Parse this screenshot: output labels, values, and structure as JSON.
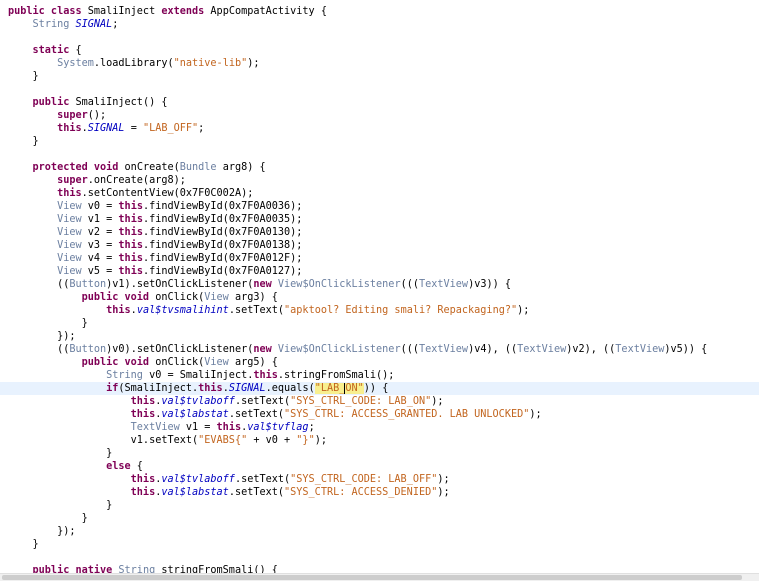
{
  "editor": {
    "current_line_index": 29,
    "lines": [
      [
        {
          "t": "public class ",
          "c": "k"
        },
        {
          "t": "SmaliInject ",
          "c": "h"
        },
        {
          "t": "extends ",
          "c": "k"
        },
        {
          "t": "AppCompatActivity {",
          "c": "h"
        }
      ],
      [
        {
          "t": "    ",
          "c": "n"
        },
        {
          "t": "String ",
          "c": "ty"
        },
        {
          "t": "SIGNAL",
          "c": "it"
        },
        {
          "t": ";",
          "c": "n"
        }
      ],
      [],
      [
        {
          "t": "    static",
          "c": "k"
        },
        {
          "t": " {",
          "c": "n"
        }
      ],
      [
        {
          "t": "        ",
          "c": "n"
        },
        {
          "t": "System",
          "c": "ty"
        },
        {
          "t": ".loadLibrary(",
          "c": "n"
        },
        {
          "t": "\"native-lib\"",
          "c": "s"
        },
        {
          "t": ");",
          "c": "n"
        }
      ],
      [
        {
          "t": "    }",
          "c": "n"
        }
      ],
      [],
      [
        {
          "t": "    public ",
          "c": "k"
        },
        {
          "t": "SmaliInject",
          "c": "h"
        },
        {
          "t": "() {",
          "c": "n"
        }
      ],
      [
        {
          "t": "        super",
          "c": "k"
        },
        {
          "t": "();",
          "c": "n"
        }
      ],
      [
        {
          "t": "        this",
          "c": "k"
        },
        {
          "t": ".",
          "c": "n"
        },
        {
          "t": "SIGNAL",
          "c": "it"
        },
        {
          "t": " = ",
          "c": "n"
        },
        {
          "t": "\"LAB_OFF\"",
          "c": "s"
        },
        {
          "t": ";",
          "c": "n"
        }
      ],
      [
        {
          "t": "    }",
          "c": "n"
        }
      ],
      [],
      [
        {
          "t": "    protected void ",
          "c": "k"
        },
        {
          "t": "onCreate(",
          "c": "n"
        },
        {
          "t": "Bundle ",
          "c": "ty"
        },
        {
          "t": "arg8) {",
          "c": "n"
        }
      ],
      [
        {
          "t": "        super",
          "c": "k"
        },
        {
          "t": ".onCreate(arg8);",
          "c": "n"
        }
      ],
      [
        {
          "t": "        this",
          "c": "k"
        },
        {
          "t": ".setContentView(",
          "c": "n"
        },
        {
          "t": "0x7F0C002A",
          "c": "n"
        },
        {
          "t": ");",
          "c": "n"
        }
      ],
      [
        {
          "t": "        ",
          "c": "n"
        },
        {
          "t": "View ",
          "c": "ty"
        },
        {
          "t": "v0 = ",
          "c": "n"
        },
        {
          "t": "this",
          "c": "k"
        },
        {
          "t": ".findViewById(0x7F0A0036);",
          "c": "n"
        }
      ],
      [
        {
          "t": "        ",
          "c": "n"
        },
        {
          "t": "View ",
          "c": "ty"
        },
        {
          "t": "v1 = ",
          "c": "n"
        },
        {
          "t": "this",
          "c": "k"
        },
        {
          "t": ".findViewById(0x7F0A0035);",
          "c": "n"
        }
      ],
      [
        {
          "t": "        ",
          "c": "n"
        },
        {
          "t": "View ",
          "c": "ty"
        },
        {
          "t": "v2 = ",
          "c": "n"
        },
        {
          "t": "this",
          "c": "k"
        },
        {
          "t": ".findViewById(0x7F0A0130);",
          "c": "n"
        }
      ],
      [
        {
          "t": "        ",
          "c": "n"
        },
        {
          "t": "View ",
          "c": "ty"
        },
        {
          "t": "v3 = ",
          "c": "n"
        },
        {
          "t": "this",
          "c": "k"
        },
        {
          "t": ".findViewById(0x7F0A0138);",
          "c": "n"
        }
      ],
      [
        {
          "t": "        ",
          "c": "n"
        },
        {
          "t": "View ",
          "c": "ty"
        },
        {
          "t": "v4 = ",
          "c": "n"
        },
        {
          "t": "this",
          "c": "k"
        },
        {
          "t": ".findViewById(0x7F0A012F);",
          "c": "n"
        }
      ],
      [
        {
          "t": "        ",
          "c": "n"
        },
        {
          "t": "View ",
          "c": "ty"
        },
        {
          "t": "v5 = ",
          "c": "n"
        },
        {
          "t": "this",
          "c": "k"
        },
        {
          "t": ".findViewById(0x7F0A0127);",
          "c": "n"
        }
      ],
      [
        {
          "t": "        ((",
          "c": "n"
        },
        {
          "t": "Button",
          "c": "ty"
        },
        {
          "t": ")v1).setOnClickListener(",
          "c": "n"
        },
        {
          "t": "new ",
          "c": "k"
        },
        {
          "t": "View$OnClickListener",
          "c": "ty"
        },
        {
          "t": "(((",
          "c": "n"
        },
        {
          "t": "TextView",
          "c": "ty"
        },
        {
          "t": ")v3)) {",
          "c": "n"
        }
      ],
      [
        {
          "t": "            public void ",
          "c": "k"
        },
        {
          "t": "onClick(",
          "c": "n"
        },
        {
          "t": "View ",
          "c": "ty"
        },
        {
          "t": "arg3) {",
          "c": "n"
        }
      ],
      [
        {
          "t": "                this",
          "c": "k"
        },
        {
          "t": ".",
          "c": "n"
        },
        {
          "t": "val$tvsmalihint",
          "c": "it"
        },
        {
          "t": ".setText(",
          "c": "n"
        },
        {
          "t": "\"apktool? Editing smali? Repackaging?\"",
          "c": "s"
        },
        {
          "t": ");",
          "c": "n"
        }
      ],
      [
        {
          "t": "            }",
          "c": "n"
        }
      ],
      [
        {
          "t": "        });",
          "c": "n"
        }
      ],
      [
        {
          "t": "        ((",
          "c": "n"
        },
        {
          "t": "Button",
          "c": "ty"
        },
        {
          "t": ")v0).setOnClickListener(",
          "c": "n"
        },
        {
          "t": "new ",
          "c": "k"
        },
        {
          "t": "View$OnClickListener",
          "c": "ty"
        },
        {
          "t": "(((",
          "c": "n"
        },
        {
          "t": "TextView",
          "c": "ty"
        },
        {
          "t": ")v4), ((",
          "c": "n"
        },
        {
          "t": "TextView",
          "c": "ty"
        },
        {
          "t": ")v2), ((",
          "c": "n"
        },
        {
          "t": "TextView",
          "c": "ty"
        },
        {
          "t": ")v5)) {",
          "c": "n"
        }
      ],
      [
        {
          "t": "            public void ",
          "c": "k"
        },
        {
          "t": "onClick(",
          "c": "n"
        },
        {
          "t": "View ",
          "c": "ty"
        },
        {
          "t": "arg5) {",
          "c": "n"
        }
      ],
      [
        {
          "t": "                ",
          "c": "n"
        },
        {
          "t": "String ",
          "c": "ty"
        },
        {
          "t": "v0 = SmaliInject.",
          "c": "n"
        },
        {
          "t": "this",
          "c": "k"
        },
        {
          "t": ".stringFromSmali();",
          "c": "n"
        }
      ],
      [
        {
          "t": "                if",
          "c": "k"
        },
        {
          "t": "(SmaliInject.",
          "c": "n"
        },
        {
          "t": "this",
          "c": "k"
        },
        {
          "t": ".",
          "c": "n"
        },
        {
          "t": "SIGNAL",
          "c": "it"
        },
        {
          "t": ".equals(",
          "c": "n"
        },
        {
          "t": "\"LAB_",
          "c": "hl"
        },
        {
          "t": "ON\"",
          "c": "hlc"
        },
        {
          "t": ")) {",
          "c": "n"
        }
      ],
      [
        {
          "t": "                    this",
          "c": "k"
        },
        {
          "t": ".",
          "c": "n"
        },
        {
          "t": "val$tvlaboff",
          "c": "it"
        },
        {
          "t": ".setText(",
          "c": "n"
        },
        {
          "t": "\"SYS_CTRL_CODE: LAB_ON\"",
          "c": "s"
        },
        {
          "t": ");",
          "c": "n"
        }
      ],
      [
        {
          "t": "                    this",
          "c": "k"
        },
        {
          "t": ".",
          "c": "n"
        },
        {
          "t": "val$labstat",
          "c": "it"
        },
        {
          "t": ".setText(",
          "c": "n"
        },
        {
          "t": "\"SYS_CTRL: ACCESS_GRANTED. LAB UNLOCKED\"",
          "c": "s"
        },
        {
          "t": ");",
          "c": "n"
        }
      ],
      [
        {
          "t": "                    ",
          "c": "n"
        },
        {
          "t": "TextView ",
          "c": "ty"
        },
        {
          "t": "v1 = ",
          "c": "n"
        },
        {
          "t": "this",
          "c": "k"
        },
        {
          "t": ".",
          "c": "n"
        },
        {
          "t": "val$tvflag",
          "c": "it"
        },
        {
          "t": ";",
          "c": "n"
        }
      ],
      [
        {
          "t": "                    v1.setText(",
          "c": "n"
        },
        {
          "t": "\"EVABS{\"",
          "c": "s"
        },
        {
          "t": " + v0 + ",
          "c": "n"
        },
        {
          "t": "\"}\"",
          "c": "s"
        },
        {
          "t": ");",
          "c": "n"
        }
      ],
      [
        {
          "t": "                }",
          "c": "n"
        }
      ],
      [
        {
          "t": "                else",
          "c": "k"
        },
        {
          "t": " {",
          "c": "n"
        }
      ],
      [
        {
          "t": "                    this",
          "c": "k"
        },
        {
          "t": ".",
          "c": "n"
        },
        {
          "t": "val$tvlaboff",
          "c": "it"
        },
        {
          "t": ".setText(",
          "c": "n"
        },
        {
          "t": "\"SYS_CTRL_CODE: LAB_OFF\"",
          "c": "s"
        },
        {
          "t": ");",
          "c": "n"
        }
      ],
      [
        {
          "t": "                    this",
          "c": "k"
        },
        {
          "t": ".",
          "c": "n"
        },
        {
          "t": "val$labstat",
          "c": "it"
        },
        {
          "t": ".setText(",
          "c": "n"
        },
        {
          "t": "\"SYS_CTRL: ACCESS_DENIED\"",
          "c": "s"
        },
        {
          "t": ");",
          "c": "n"
        }
      ],
      [
        {
          "t": "                }",
          "c": "n"
        }
      ],
      [
        {
          "t": "            }",
          "c": "n"
        }
      ],
      [
        {
          "t": "        });",
          "c": "n"
        }
      ],
      [
        {
          "t": "    }",
          "c": "n"
        }
      ],
      [],
      [
        {
          "t": "    public native ",
          "c": "k"
        },
        {
          "t": "String ",
          "c": "ty"
        },
        {
          "t": "stringFromSmali() {",
          "c": "n"
        }
      ]
    ]
  },
  "colors": {
    "keyword": "#7f0055",
    "type": "#6b7fa0",
    "string": "#c2651f",
    "current_line": "#e8f2fe",
    "match_highlight": "#f8ef8f"
  }
}
